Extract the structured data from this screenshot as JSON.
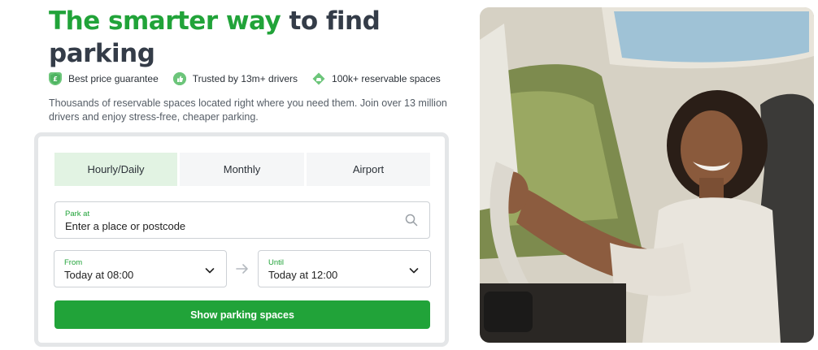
{
  "hero": {
    "title_accent": "The smarter way",
    "title_rest": " to find parking"
  },
  "badges": [
    {
      "label": "Best price guarantee",
      "icon": "shield-pound-icon"
    },
    {
      "label": "Trusted by 13m+ drivers",
      "icon": "thumbs-up-icon"
    },
    {
      "label": "100k+ reservable spaces",
      "icon": "parking-car-icon"
    }
  ],
  "intro": "Thousands of reservable spaces located right where you need them. Join over 13 million drivers and enjoy stress-free, cheaper parking.",
  "search": {
    "tabs": [
      {
        "label": "Hourly/Daily",
        "active": true
      },
      {
        "label": "Monthly",
        "active": false
      },
      {
        "label": "Airport",
        "active": false
      }
    ],
    "park_at": {
      "label": "Park at",
      "placeholder": "Enter a place or postcode"
    },
    "from": {
      "label": "From",
      "value": "Today at 08:00"
    },
    "until": {
      "label": "Until",
      "value": "Today at 12:00"
    },
    "submit_label": "Show parking spaces"
  },
  "colors": {
    "brand_green": "#21a339",
    "heading": "#343c48",
    "tab_active_bg": "#e2f3e3"
  }
}
